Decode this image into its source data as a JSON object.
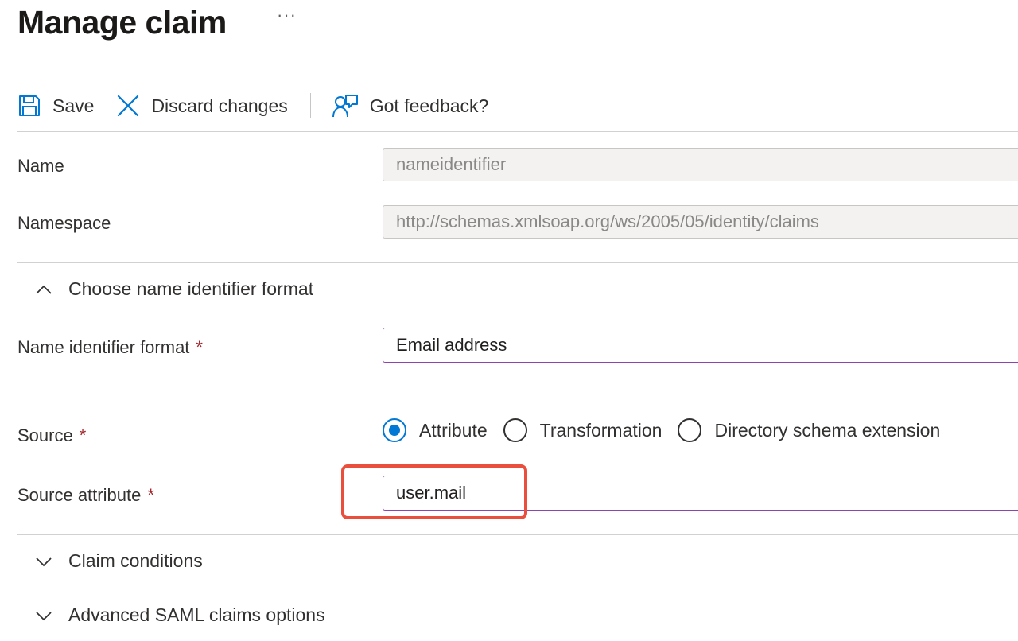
{
  "header": {
    "title": "Manage claim",
    "more_label": "···"
  },
  "toolbar": {
    "save_label": "Save",
    "discard_label": "Discard changes",
    "feedback_label": "Got feedback?"
  },
  "form": {
    "name": {
      "label": "Name",
      "value": "nameidentifier"
    },
    "namespace": {
      "label": "Namespace",
      "value": "http://schemas.xmlsoap.org/ws/2005/05/identity/claims"
    },
    "name_id_section": {
      "title": "Choose name identifier format",
      "expanded": true
    },
    "name_id_format": {
      "label": "Name identifier format",
      "required_mark": "*",
      "value": "Email address"
    },
    "source": {
      "label": "Source",
      "required_mark": "*",
      "options": [
        "Attribute",
        "Transformation",
        "Directory schema extension"
      ],
      "selected": "Attribute"
    },
    "source_attribute": {
      "label": "Source attribute",
      "required_mark": "*",
      "value": "user.mail"
    },
    "claim_conditions": {
      "title": "Claim conditions",
      "expanded": false
    },
    "advanced_saml": {
      "title": "Advanced SAML claims options",
      "expanded": false
    }
  },
  "colors": {
    "accent": "#0078d4",
    "focus_border": "#8e44ad",
    "required": "#a4262c",
    "highlight": "#ea4f3d"
  }
}
